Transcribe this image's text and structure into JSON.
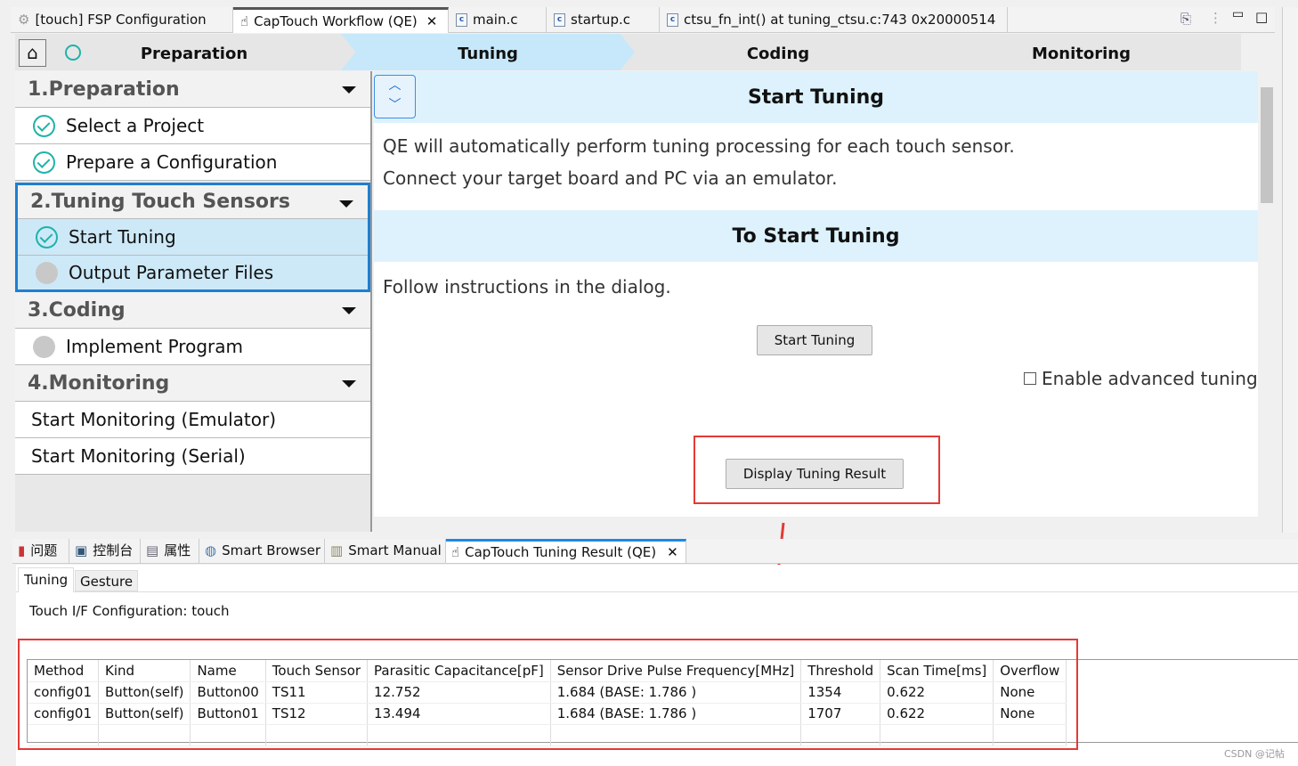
{
  "editor_tabs": [
    {
      "label": "[touch] FSP Configuration",
      "icon": "gear-icon"
    },
    {
      "label": "CapTouch Workflow (QE)",
      "icon": "hand-icon",
      "active": true
    },
    {
      "label": "main.c",
      "icon": "c-file-icon"
    },
    {
      "label": "startup.c",
      "icon": "c-file-icon"
    },
    {
      "label": "ctsu_fn_int() at tuning_ctsu.c:743 0x20000514",
      "icon": "c-file-icon"
    }
  ],
  "steps": [
    "Preparation",
    "Tuning",
    "Coding",
    "Monitoring"
  ],
  "sidebar": {
    "sections": [
      {
        "title": "1.Preparation",
        "items": [
          {
            "label": "Select a Project",
            "status": "done"
          },
          {
            "label": "Prepare a Configuration",
            "status": "done"
          }
        ]
      },
      {
        "title": "2.Tuning Touch Sensors",
        "items": [
          {
            "label": "Start Tuning",
            "status": "done"
          },
          {
            "label": "Output Parameter Files",
            "status": "pending"
          }
        ]
      },
      {
        "title": "3.Coding",
        "items": [
          {
            "label": "Implement Program",
            "status": "pending"
          }
        ]
      },
      {
        "title": "4.Monitoring",
        "items": [
          {
            "label": "Start Monitoring (Emulator)"
          },
          {
            "label": "Start Monitoring (Serial)"
          }
        ]
      }
    ]
  },
  "main": {
    "heading1": "Start Tuning",
    "text1": "QE will automatically perform tuning processing for each touch sensor.",
    "text2": "Connect your target board and PC via an emulator.",
    "heading2": "To Start Tuning",
    "text3": "Follow instructions in the dialog.",
    "start_button": "Start Tuning",
    "advanced_checkbox": "Enable advanced tuning",
    "display_button": "Display Tuning Result"
  },
  "bottom_tabs": [
    "问题",
    "控制台",
    "属性",
    "Smart Browser",
    "Smart Manual",
    "CapTouch Tuning Result (QE)"
  ],
  "result": {
    "subtabs": [
      "Tuning",
      "Gesture"
    ],
    "config_label": "Touch I/F Configuration: touch",
    "columns": [
      "Method",
      "Kind",
      "Name",
      "Touch Sensor",
      "Parasitic Capacitance[pF]",
      "Sensor Drive Pulse Frequency[MHz]",
      "Threshold",
      "Scan Time[ms]",
      "Overflow"
    ],
    "rows": [
      [
        "config01",
        "Button(self)",
        "Button00",
        "TS11",
        "12.752",
        "1.684 (BASE: 1.786 )",
        "1354",
        "0.622",
        "None"
      ],
      [
        "config01",
        "Button(self)",
        "Button01",
        "TS12",
        "13.494",
        "1.684 (BASE: 1.786 )",
        "1707",
        "0.622",
        "None"
      ]
    ]
  },
  "watermark": "CSDN @记帖",
  "colors": {
    "highlight": "#e53935",
    "band": "#ddf2fc",
    "check": "#20b2aa"
  }
}
